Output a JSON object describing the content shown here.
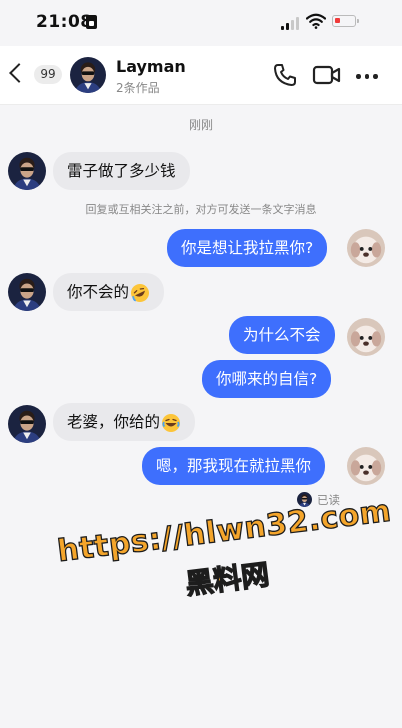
{
  "status_bar": {
    "time": "21:08"
  },
  "header": {
    "unread_count": "99",
    "contact_name": "Layman",
    "contact_subtitle": "2条作品"
  },
  "chat": {
    "time_divider": "刚刚",
    "system_note": "回复或互相关注之前，对方可发送一条文字消息",
    "messages": [
      {
        "side": "incoming",
        "text": "雷子做了多少钱"
      },
      {
        "side": "outgoing",
        "text": "你是想让我拉黑你?"
      },
      {
        "side": "incoming",
        "text": "你不会的",
        "emoji": "rolling-laughing-emoji"
      },
      {
        "side": "outgoing",
        "text": "为什么不会"
      },
      {
        "side": "outgoing",
        "text": "你哪来的自信?"
      },
      {
        "side": "incoming",
        "text": "老婆，你给的",
        "emoji": "crying-laughing-emoji"
      },
      {
        "side": "outgoing",
        "text": "嗯，那我现在就拉黑你"
      }
    ],
    "read_status": "已读"
  },
  "watermark": {
    "url": "https://hlwn32.com",
    "name": "黑料网"
  },
  "colors": {
    "outgoing_bubble": "#3e6ffd",
    "incoming_bubble": "#e9e9ec",
    "watermark": "#f4a52b"
  }
}
